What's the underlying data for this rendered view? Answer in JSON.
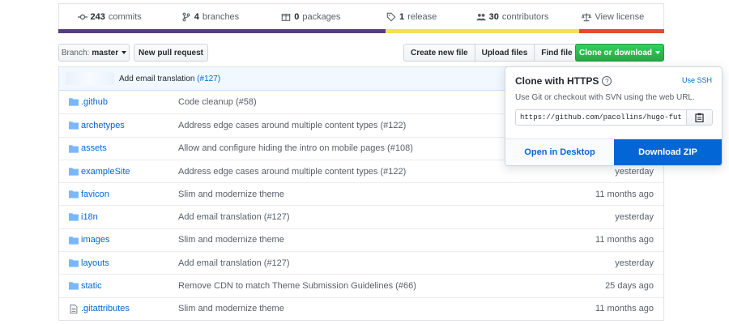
{
  "summary": {
    "commits_count": "243",
    "commits_label": "commits",
    "branches_count": "4",
    "branches_label": "branches",
    "packages_count": "0",
    "packages_label": "packages",
    "releases_count": "1",
    "releases_label": "release",
    "contributors_count": "30",
    "contributors_label": "contributors",
    "license_label": "View license"
  },
  "language_bar": [
    {
      "color": "#563d7c",
      "fraction": 0.54
    },
    {
      "color": "#f1e05a",
      "fraction": 0.32
    },
    {
      "color": "#e34c26",
      "fraction": 0.14
    }
  ],
  "toolbar": {
    "branch_prefix": "Branch:",
    "branch_name": "master",
    "new_pull_request": "New pull request",
    "create_new_file": "Create new file",
    "upload_files": "Upload files",
    "find_file": "Find file",
    "clone_or_download": "Clone or download"
  },
  "latest_commit": {
    "message": "Add email translation",
    "link": "(#127)"
  },
  "files": [
    {
      "name": ".github",
      "type": "folder",
      "message": "Code cleanup (#58)",
      "age": ""
    },
    {
      "name": "archetypes",
      "type": "folder",
      "message": "Address edge cases around multiple content types (#122)",
      "age": ""
    },
    {
      "name": "assets",
      "type": "folder",
      "message": "Allow and configure hiding the intro on mobile pages (#108)",
      "age": ""
    },
    {
      "name": "exampleSite",
      "type": "folder",
      "message": "Address edge cases around multiple content types (#122)",
      "age": "yesterday"
    },
    {
      "name": "favicon",
      "type": "folder",
      "message": "Slim and modernize theme",
      "age": "11 months ago"
    },
    {
      "name": "i18n",
      "type": "folder",
      "message": "Add email translation (#127)",
      "age": "yesterday"
    },
    {
      "name": "images",
      "type": "folder",
      "message": "Slim and modernize theme",
      "age": "11 months ago"
    },
    {
      "name": "layouts",
      "type": "folder",
      "message": "Add email translation (#127)",
      "age": "yesterday"
    },
    {
      "name": "static",
      "type": "folder",
      "message": "Remove CDN to match Theme Submission Guidelines (#66)",
      "age": "25 days ago"
    },
    {
      "name": ".gitattributes",
      "type": "file",
      "message": "Slim and modernize theme",
      "age": "11 months ago"
    }
  ],
  "clone_popup": {
    "title": "Clone with HTTPS",
    "help_glyph": "?",
    "use_ssh": "Use SSH",
    "description": "Use Git or checkout with SVN using the web URL.",
    "url": "https://github.com/pacollins/hugo-fut",
    "open_in_desktop": "Open in Desktop",
    "download_zip": "Download ZIP"
  },
  "colors": {
    "link_blue": "#0366d6",
    "primary_green": "#28a745",
    "commit_bar_bg": "#f1f8ff"
  }
}
